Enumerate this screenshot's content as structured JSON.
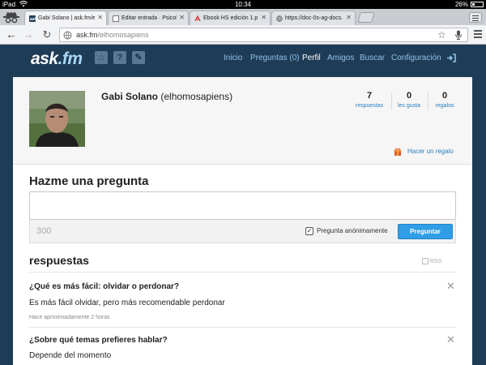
{
  "status_bar": {
    "device": "iPad",
    "time": "10:34",
    "battery": "26%"
  },
  "browser": {
    "tabs": [
      {
        "title": "Gabi Solano | ask.fm/e",
        "active": true
      },
      {
        "title": "Editar entrada · Psicol",
        "active": false
      },
      {
        "title": "Ebook HS edición 1.p",
        "active": false
      },
      {
        "title": "https://doc-0s-ag-docs.",
        "active": false
      }
    ],
    "url_host": "ask.fm",
    "url_path": "/elhomosapiens"
  },
  "site": {
    "logo_main": "ask",
    "logo_suffix": ".fm",
    "nav": [
      "Inicio",
      "Preguntas (0)",
      "Perfil",
      "Amigos",
      "Buscar",
      "Configuración"
    ],
    "active_nav": "Perfil"
  },
  "profile": {
    "name": "Gabi Solano",
    "username": "(elhomosapiens)",
    "stats": [
      {
        "value": "7",
        "label": "respuestas"
      },
      {
        "value": "0",
        "label": "les gusta"
      },
      {
        "value": "0",
        "label": "regalos"
      }
    ],
    "gift_link": "Hacer un regalo"
  },
  "ask": {
    "title": "Hazme una pregunta",
    "counter": "300",
    "anonymous_label": "Pregunta anónimamente",
    "anonymous_checked": true,
    "button": "Preguntar"
  },
  "answers": {
    "title": "respuestas",
    "rss": "RSS",
    "items": [
      {
        "question": "¿Qué es más fácil: olvidar o perdonar?",
        "answer": "Es más fácil olvidar, pero más recomendable perdonar",
        "time": "Hace aproximadamente 2 horas"
      },
      {
        "question": "¿Sobre qué temas prefieres hablar?",
        "answer": "Depende del momento"
      }
    ]
  },
  "colors": {
    "header_bg": "#1f3c57",
    "link": "#2a7fbf",
    "button": "#2f9ee6",
    "nav_link": "#8fc1e6"
  }
}
